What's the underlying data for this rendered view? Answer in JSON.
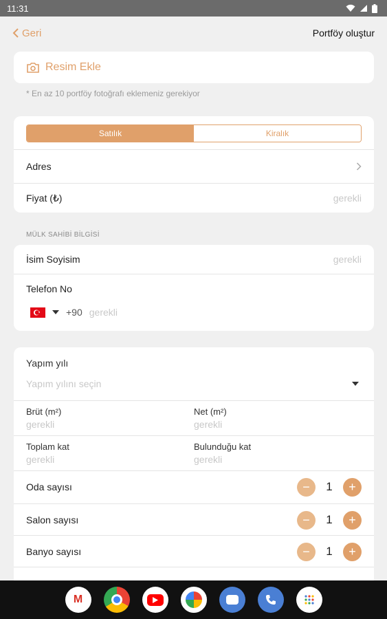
{
  "status": {
    "time": "11:31"
  },
  "nav": {
    "back_label": "Geri",
    "title": "Portföy oluştur"
  },
  "photo": {
    "add_label": "Resim Ekle",
    "note": "* En az 10 portföy fotoğrafı eklemeniz gerekiyor"
  },
  "listing_type": {
    "options": [
      "Satılık",
      "Kiralık"
    ],
    "selected": "Satılık"
  },
  "address": {
    "label": "Adres"
  },
  "price": {
    "label": "Fiyat (₺)",
    "placeholder": "gerekli"
  },
  "owner": {
    "section_label": "MÜLK SAHİBİ BİLGİSİ",
    "name_label": "İsim Soyisim",
    "name_placeholder": "gerekli",
    "phone_label": "Telefon No",
    "dial_code": "+90",
    "phone_placeholder": "gerekli"
  },
  "details": {
    "year_label": "Yapım yılı",
    "year_placeholder": "Yapım yılını seçin",
    "gross_label": "Brüt (m²)",
    "gross_placeholder": "gerekli",
    "net_label": "Net (m²)",
    "net_placeholder": "gerekli",
    "total_floor_label": "Toplam kat",
    "total_floor_placeholder": "gerekli",
    "floor_label": "Bulunduğu kat",
    "floor_placeholder": "gerekli",
    "rooms_label": "Oda sayısı",
    "rooms_value": "1",
    "salons_label": "Salon sayısı",
    "salons_value": "1",
    "baths_label": "Banyo sayısı",
    "baths_value": "1"
  },
  "colors": {
    "accent": "#e0a06a",
    "background": "#f0f0f0"
  },
  "dock_apps": [
    "gmail-icon",
    "chrome-icon",
    "youtube-icon",
    "photos-icon",
    "messages-icon",
    "phone-icon",
    "apps-icon"
  ]
}
